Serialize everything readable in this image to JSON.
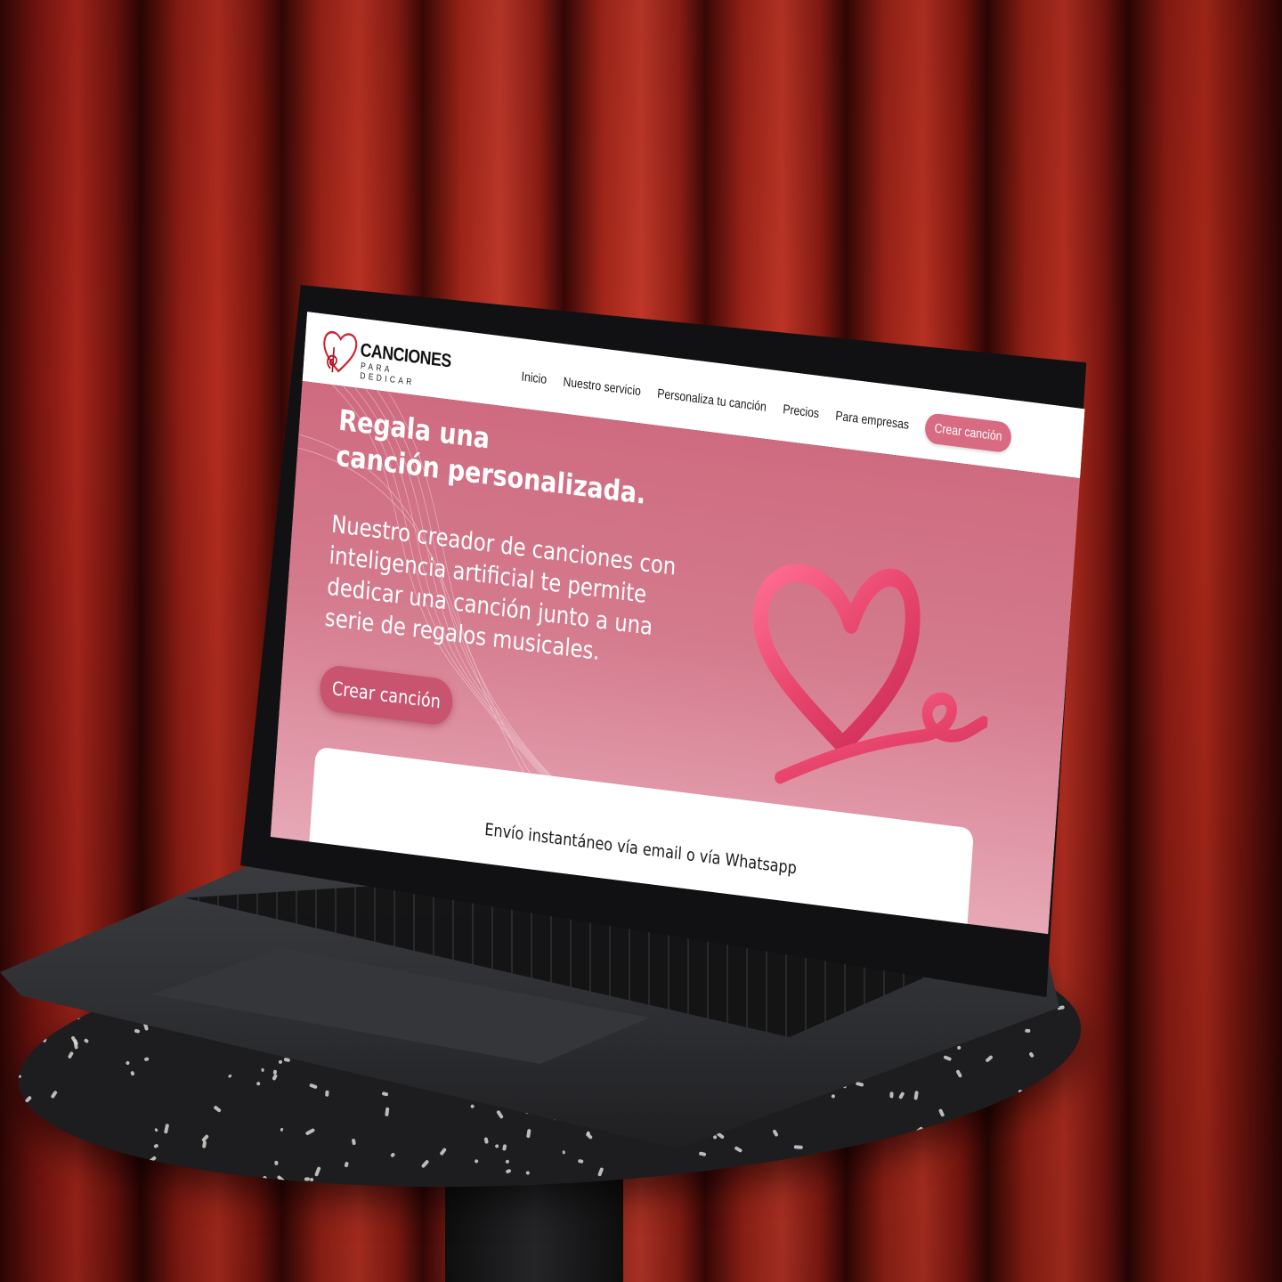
{
  "site": {
    "logo": {
      "title": "CANCIONES",
      "subtitle": "PARA DEDICAR",
      "icon": "heart-treble-clef-icon"
    },
    "nav": {
      "items": [
        {
          "label": "Inicio"
        },
        {
          "label": "Nuestro servicio"
        },
        {
          "label": "Personaliza tu canción"
        },
        {
          "label": "Precios"
        },
        {
          "label": "Para empresas"
        }
      ],
      "cta_label": "Crear canción"
    },
    "hero": {
      "title_line1": "Regala una",
      "title_line2": "canción personalizada.",
      "description": "Nuestro creador de canciones con inteligencia artificial te permite dedicar una canción junto a una serie de regalos musicales.",
      "cta_label": "Crear canción",
      "illustration": "3d-heart-ribbon-icon"
    },
    "info_card": {
      "text": "Envío instantáneo vía email o vía Whatsapp"
    }
  },
  "colors": {
    "accent": "#d86b81",
    "hero_top": "#cf6b80",
    "hero_bottom": "#e7a8b6",
    "heart": "#e8456c",
    "curtain": "#a8261b"
  }
}
